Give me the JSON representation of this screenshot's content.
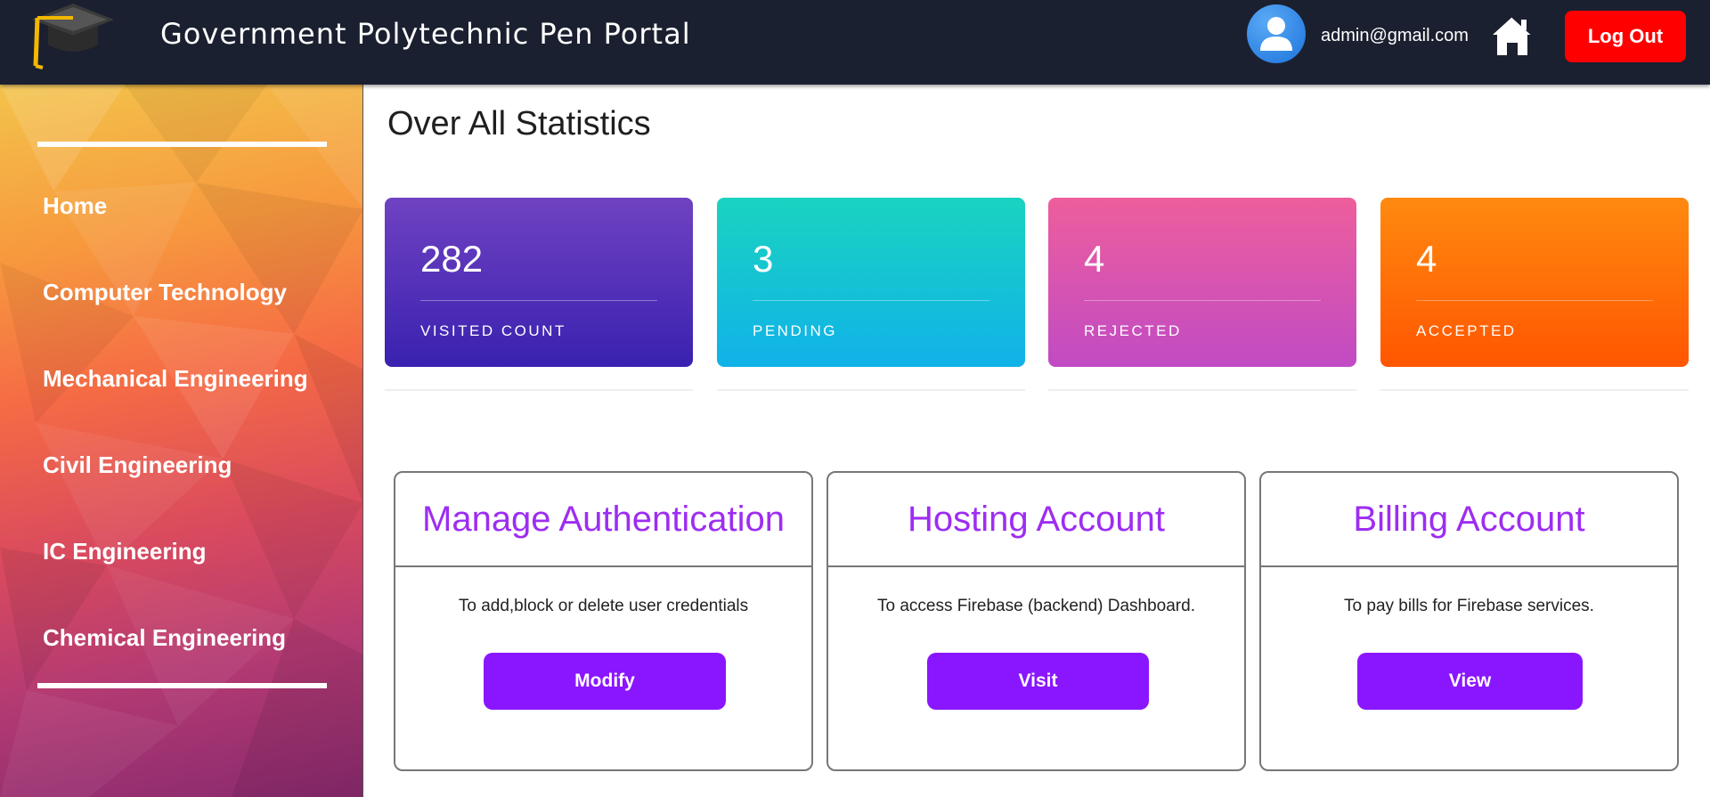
{
  "header": {
    "title": "Government Polytechnic Pen Portal",
    "user_email": "admin@gmail.com",
    "logout_label": "Log Out",
    "icons": {
      "logo": "graduation-cap-icon",
      "avatar": "user-avatar-icon",
      "home": "home-icon"
    }
  },
  "sidebar": {
    "items": [
      {
        "label": "Home"
      },
      {
        "label": "Computer Technology"
      },
      {
        "label": "Mechanical Engineering"
      },
      {
        "label": "Civil Engineering"
      },
      {
        "label": "IC Engineering"
      },
      {
        "label": "Chemical Engineering"
      }
    ]
  },
  "main": {
    "title": "Over All Statistics",
    "stats": [
      {
        "value": "282",
        "label": "VISITED COUNT",
        "colors": [
          "#6f42c1",
          "#3a21b0"
        ]
      },
      {
        "value": "3",
        "label": "PENDING",
        "colors": [
          "#1ad3c0",
          "#10b2e8"
        ]
      },
      {
        "value": "4",
        "label": "REJECTED",
        "colors": [
          "#ee5e9c",
          "#c14bc4"
        ]
      },
      {
        "value": "4",
        "label": "ACCEPTED",
        "colors": [
          "#ff8a10",
          "#ff5600"
        ]
      }
    ],
    "panels": [
      {
        "title": "Manage Authentication",
        "description": "To add,block or delete user credentials",
        "button": "Modify"
      },
      {
        "title": "Hosting Account",
        "description": "To access Firebase (backend) Dashboard.",
        "button": "Visit"
      },
      {
        "title": "Billing Account",
        "description": "To pay bills for Firebase services.",
        "button": "View"
      }
    ]
  },
  "colors": {
    "topbar": "#1b2030",
    "logout": "#ff0000",
    "accent_purple": "#8a16ff",
    "panel_title": "#9d2df2"
  }
}
